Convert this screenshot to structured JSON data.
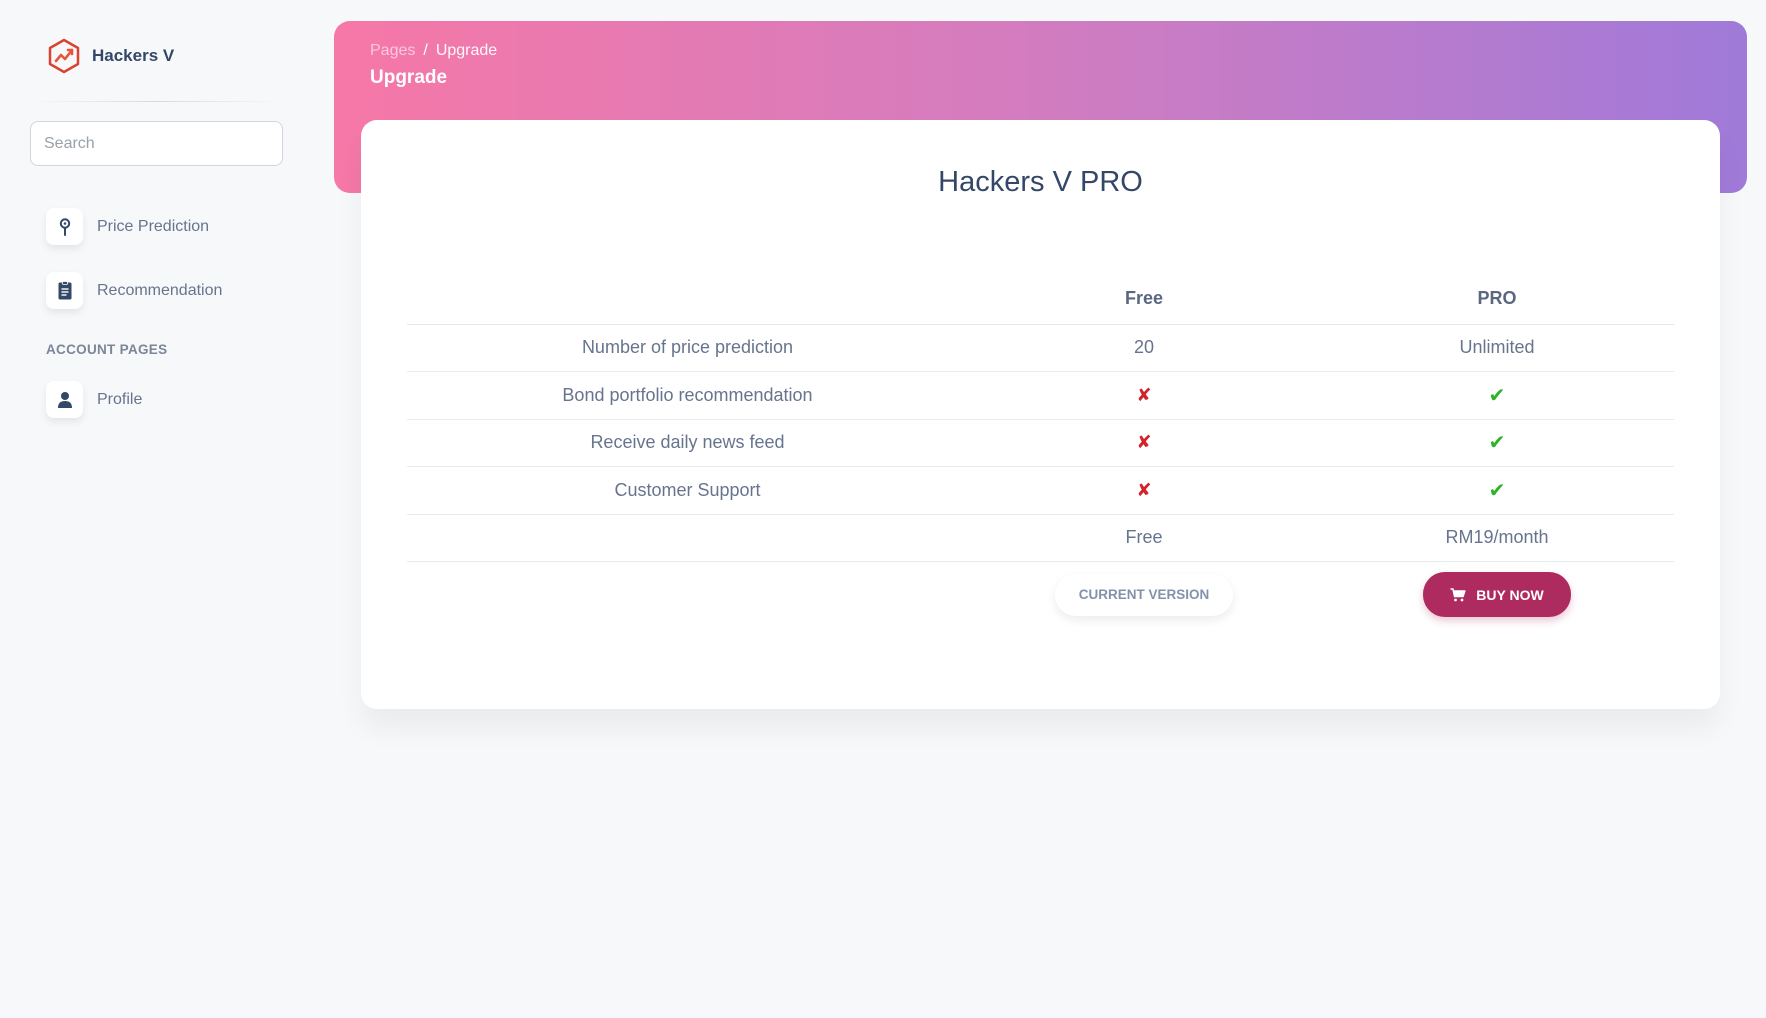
{
  "sidebar": {
    "brand_name": "Hackers V",
    "search_placeholder": "Search",
    "items": [
      {
        "label": "Price Prediction",
        "icon": "map-pin-icon"
      },
      {
        "label": "Recommendation",
        "icon": "clipboard-icon"
      }
    ],
    "section_heading": "ACCOUNT PAGES",
    "account_items": [
      {
        "label": "Profile",
        "icon": "user-icon"
      }
    ]
  },
  "header": {
    "breadcrumb_parent": "Pages",
    "breadcrumb_separator": "/",
    "breadcrumb_current": "Upgrade",
    "title": "Upgrade"
  },
  "card": {
    "title": "Hackers V PRO",
    "columns": [
      "",
      "Free",
      "PRO"
    ],
    "rows": [
      {
        "feature": "Number of price prediction",
        "free": "20",
        "pro": "Unlimited"
      },
      {
        "feature": "Bond portfolio recommendation",
        "free": "✘",
        "pro": "✔"
      },
      {
        "feature": "Receive daily news feed",
        "free": "✘",
        "pro": "✔"
      },
      {
        "feature": "Customer Support",
        "free": "✘",
        "pro": "✔"
      }
    ],
    "price_row": {
      "free": "Free",
      "pro": "RM19/month"
    },
    "current_version_label": "CURRENT VERSION",
    "buy_now_label": "BUY NOW"
  },
  "colors": {
    "banner_start": "#f678a7",
    "banner_end": "#a07ad9",
    "buy_button": "#ad2b5f",
    "check_green": "#2eb22b",
    "cross_red": "#d2232a"
  }
}
